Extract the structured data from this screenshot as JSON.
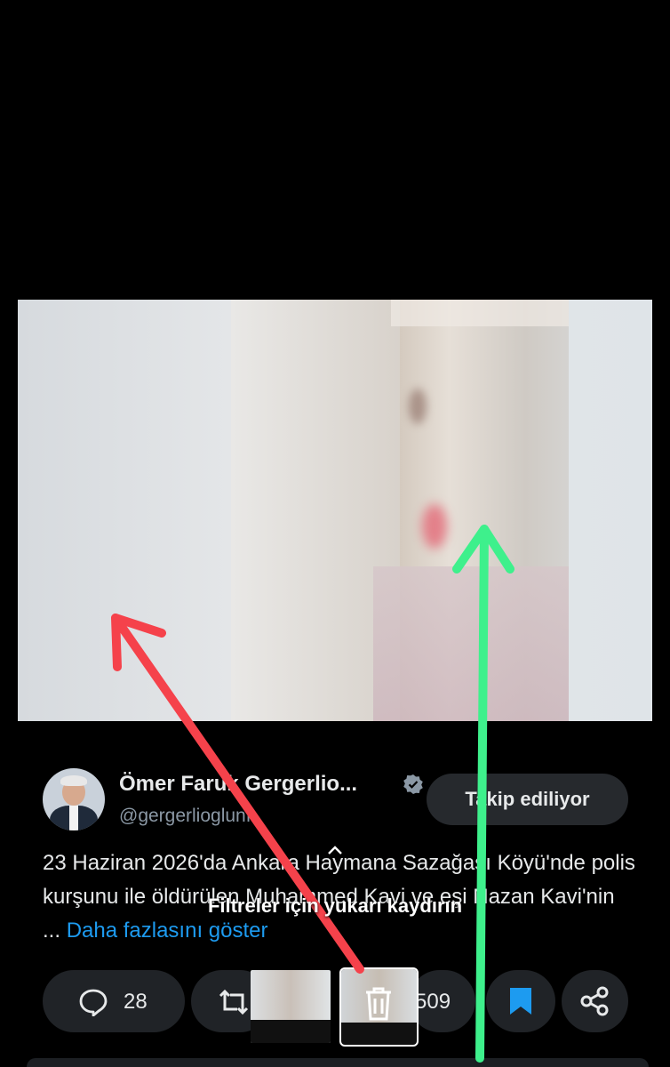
{
  "author": {
    "name": "Ömer Faruk Gergerlio...",
    "handle": "@gergerlioglunf",
    "follow_button": "Takip ediliyor"
  },
  "tweet": {
    "text": "23 Haziran 2026'da Ankara Haymana Sazağası Köyü'nde polis kurşunu ile öldürülen Muhammed Kavi ve eşi Nazan Kavi'nin ...",
    "more_link": "Daha fazlasını göster"
  },
  "overlay": {
    "hint": "Filtreler için yukarı kaydırın"
  },
  "actions": {
    "replies": "28",
    "likes": "509"
  },
  "colors": {
    "red_arrow": "#f5424b",
    "green_arrow": "#3ef08c",
    "link": "#1d9bf0"
  }
}
